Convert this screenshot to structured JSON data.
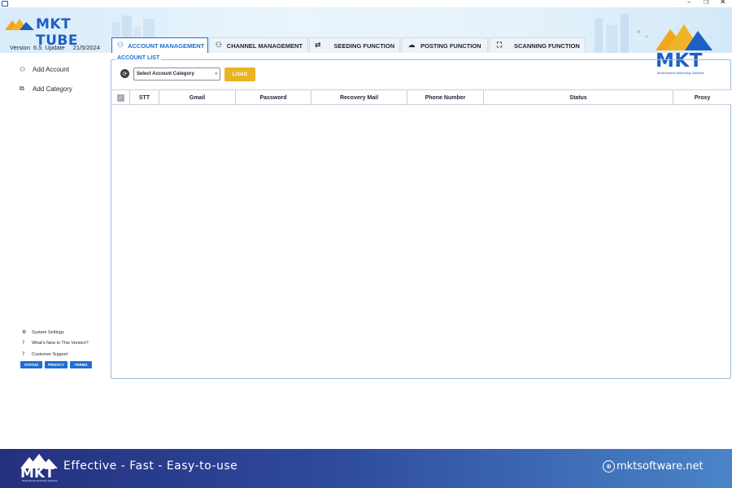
{
  "window": {
    "minimize_glyph": "–",
    "maximize_glyph": "❐",
    "close_glyph": "✕"
  },
  "app": {
    "logo_text": "MKT TUBE",
    "version_label": "Version",
    "version_number": "6.5",
    "update_label": "Update",
    "update_date": "21/5/2024"
  },
  "tabs": [
    {
      "label": "ACCOUNT MANAGEMENT",
      "icon": "accounts-icon",
      "active": true
    },
    {
      "label": "CHANNEL MANAGEMENT",
      "icon": "channels-icon",
      "active": false
    },
    {
      "label": "SEEDING FUNCTION",
      "icon": "swap-arrows-icon",
      "active": false
    },
    {
      "label": "POSTING FUNCTION",
      "icon": "cloud-upload-icon",
      "active": false
    },
    {
      "label": "SCANNING FUNCTION",
      "icon": "scan-icon",
      "active": false
    }
  ],
  "brand_watermark": {
    "text": "MKT",
    "subtitle": "Multichannel Marketing Software"
  },
  "sidebar": {
    "items": [
      {
        "label": "Add Account",
        "icon": "add-user-icon"
      },
      {
        "label": "Add Category",
        "icon": "add-category-icon"
      }
    ],
    "footer_items": [
      {
        "label": "System Settings",
        "icon": "gear-icon"
      },
      {
        "label": "What's New in This Version?",
        "icon": "question-icon"
      },
      {
        "label": "Customer Support",
        "icon": "support-icon"
      }
    ],
    "footer_buttons": [
      "STATUS",
      "PRIVACY",
      "TERMS"
    ]
  },
  "account_list": {
    "title": "ACCOUNT LIST",
    "category_select": "Select Account Category",
    "load_button": "LOAD",
    "columns": [
      "STT",
      "Gmail",
      "Password",
      "Recovery Mail",
      "Phone Number",
      "Status",
      "Proxy"
    ],
    "rows": []
  },
  "banner": {
    "logo_text": "MKT",
    "logo_subtitle": "Multichannel Marketing Software",
    "tagline": "Effective - Fast - Easy-to-use",
    "website": "mktsoftware.net"
  },
  "colors": {
    "accent_blue": "#1f6fd0",
    "load_yellow": "#e8b422",
    "banner_dark": "#24307e",
    "banner_light": "#4a84c8"
  }
}
